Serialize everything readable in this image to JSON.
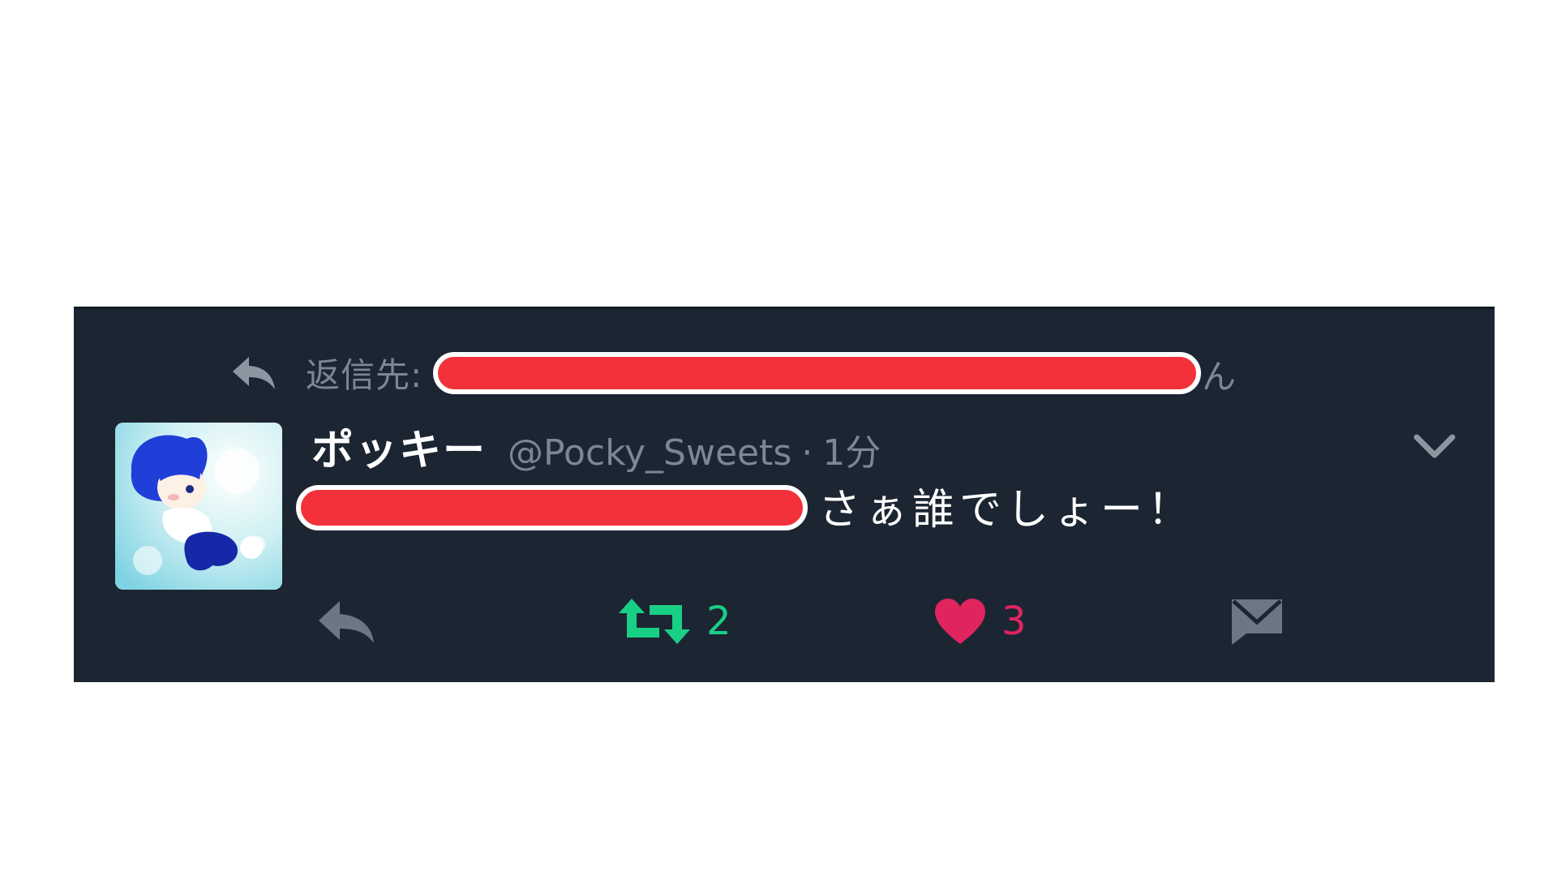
{
  "tweet": {
    "reply_prefix": "返信先:",
    "reply_tail": "ん",
    "display_name": "ポッキー",
    "handle": "@Pocky_Sweets",
    "separator": "·",
    "timestamp": "1分",
    "text": "さぁ誰でしょー！",
    "retweet_count": "2",
    "like_count": "3"
  },
  "icons": {
    "reply_to": "reply-arrow-icon",
    "menu": "chevron-down-icon",
    "reply": "reply-icon",
    "retweet": "retweet-icon",
    "like": "heart-icon",
    "dm": "envelope-icon"
  },
  "colors": {
    "card_background": "#1c2532",
    "muted_text": "#7b8793",
    "retweet_active": "#19cf86",
    "like_active": "#e0245e",
    "redaction": "#f2313b"
  }
}
